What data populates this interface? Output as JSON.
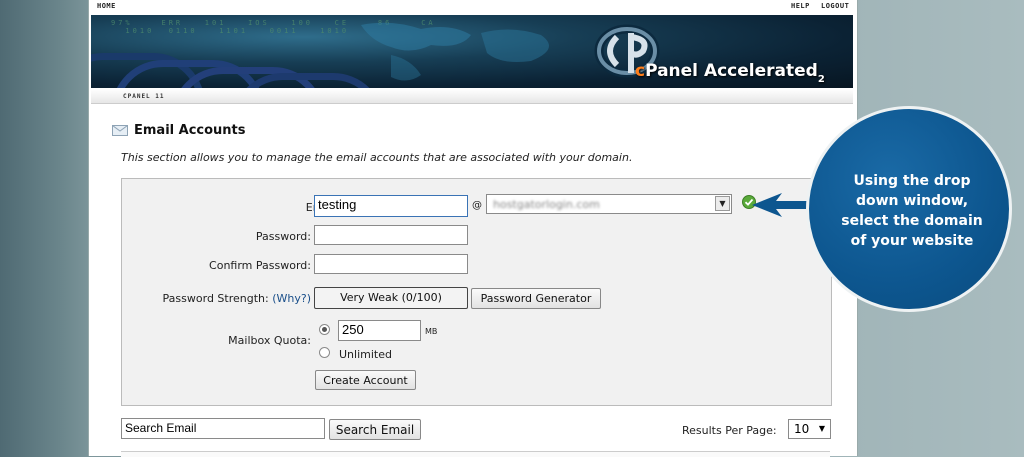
{
  "nav": {
    "home": "HOME",
    "help": "HELP",
    "logout": "LOGOUT"
  },
  "banner": {
    "digits": "97%    ERR   101   IOS   100   CE    86    CA\n  1010  0110   1101   0011   1010",
    "logo_prefix": "c",
    "logo_brand": "Panel",
    "logo_accel": "Accelerated",
    "logo_version": "2"
  },
  "subnav": {
    "label": "CPANEL 11"
  },
  "section": {
    "title": "Email Accounts",
    "description": "This section allows you to manage the email accounts that are associated with your domain."
  },
  "form": {
    "email_label": "Email:",
    "email_value": "testing",
    "at_sign": "@",
    "domain_value": "hostgatorlogin.com",
    "password_label": "Password:",
    "confirm_label": "Confirm Password:",
    "strength_label": "Password Strength:",
    "strength_why": "(Why?)",
    "strength_value": "Very Weak (0/100)",
    "generator_button": "Password Generator",
    "quota_label": "Mailbox Quota:",
    "quota_value": "250",
    "quota_unit": "MB",
    "unlimited_label": "Unlimited",
    "create_button": "Create Account"
  },
  "search": {
    "input_value": "Search Email",
    "button": "Search Email",
    "results_label": "Results Per Page:",
    "results_value": "10"
  },
  "callout": {
    "text": "Using the drop down window, select the domain of your website"
  },
  "colors": {
    "callout_blue": "#0d568f",
    "logo_orange": "#ff7e1a",
    "check_green": "#5aaa3a"
  },
  "icons": [
    "envelope-icon",
    "checkmark-icon",
    "dropdown-arrow-icon",
    "callout-pointer-icon"
  ]
}
